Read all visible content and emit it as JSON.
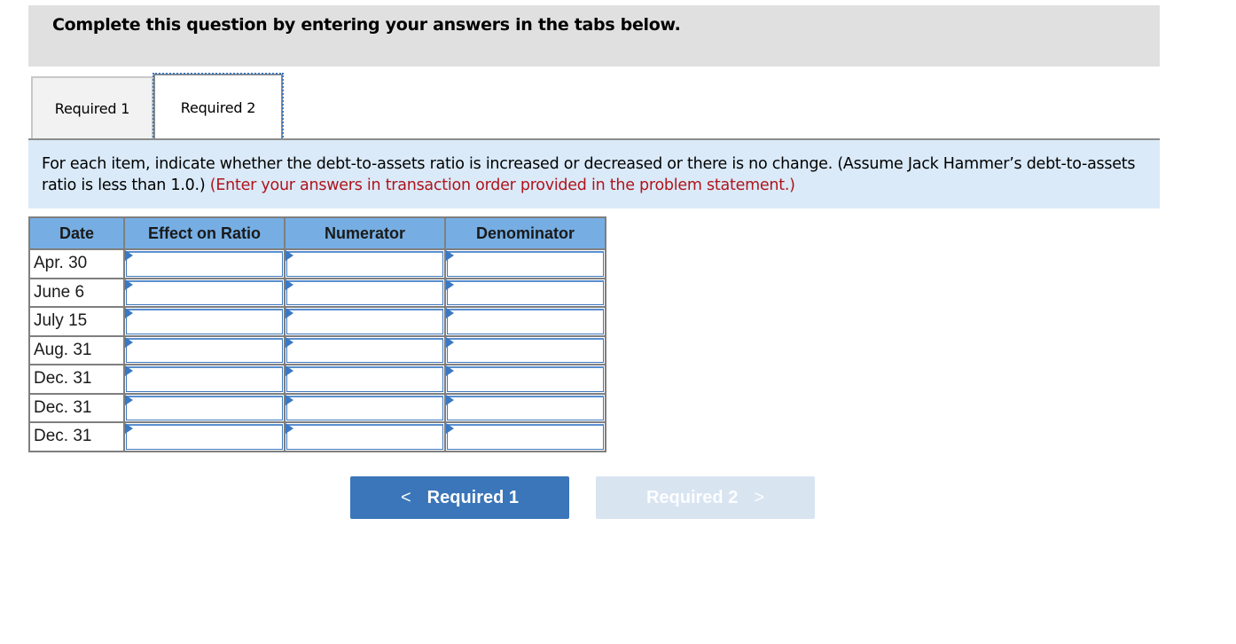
{
  "header": {
    "title": "Complete this question by entering your answers in the tabs below."
  },
  "tabs": [
    {
      "label": "Required 1",
      "active": false
    },
    {
      "label": "Required 2",
      "active": true
    }
  ],
  "instructions": {
    "text": "For each item, indicate whether the debt-to-assets ratio is increased or decreased or there is no change. (Assume Jack Hammer’s debt-to-assets ratio is less than 1.0.)",
    "note": "(Enter your answers in transaction order provided in the problem statement.)",
    "note_color": "#b0141c",
    "background": "#daeaf8"
  },
  "table": {
    "header_color": "#76aee3",
    "columns": [
      "Date",
      "Effect on Ratio",
      "Numerator",
      "Denominator"
    ],
    "rows": [
      {
        "date": "Apr. 30",
        "effect": "",
        "numerator": "",
        "denominator": ""
      },
      {
        "date": "June 6",
        "effect": "",
        "numerator": "",
        "denominator": ""
      },
      {
        "date": "July 15",
        "effect": "",
        "numerator": "",
        "denominator": ""
      },
      {
        "date": "Aug. 31",
        "effect": "",
        "numerator": "",
        "denominator": ""
      },
      {
        "date": "Dec. 31",
        "effect": "",
        "numerator": "",
        "denominator": ""
      },
      {
        "date": "Dec. 31",
        "effect": "",
        "numerator": "",
        "denominator": ""
      },
      {
        "date": "Dec. 31",
        "effect": "",
        "numerator": "",
        "denominator": ""
      }
    ]
  },
  "navigation": {
    "prev_label": "Required 1",
    "prev_icon": "chevron-left-icon",
    "prev_glyph": "<",
    "next_label": "Required 2",
    "next_icon": "chevron-right-icon",
    "next_glyph": ">",
    "next_disabled": true,
    "prev_color": "#3a76b9",
    "next_color": "#d9e4f1"
  }
}
